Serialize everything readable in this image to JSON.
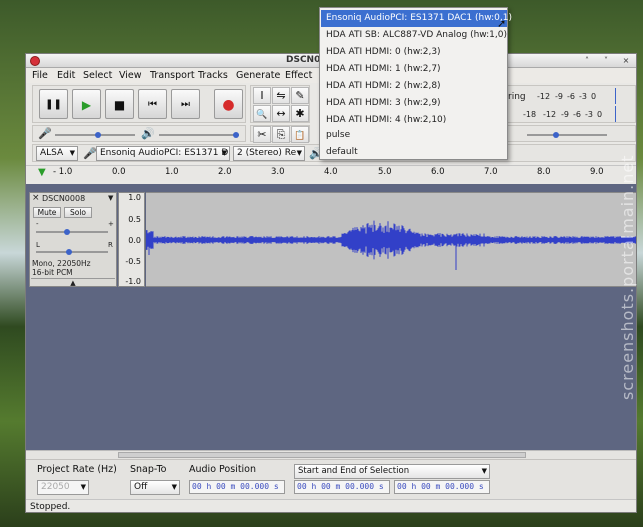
{
  "window": {
    "title": "DSCN00",
    "close": "×",
    "minimize": "˄",
    "maximize": "˅"
  },
  "menu": [
    "File",
    "Edit",
    "Select",
    "View",
    "Transport",
    "Tracks",
    "Generate",
    "Effect"
  ],
  "transport": {
    "pause": "❚❚",
    "play": "▶",
    "stop": "■",
    "skip_start": "⏮",
    "skip_end": "⏭",
    "record": "●"
  },
  "tools": {
    "select": "I",
    "envelope": "⇋",
    "draw": "✎",
    "zoom": "🔍",
    "timeshift": "↔",
    "multi": "✱"
  },
  "edit": {
    "cut": "✂",
    "copy": "⎘",
    "paste": "📋"
  },
  "meters": {
    "recording_label": "ring",
    "play_ticks": [
      "-12",
      "-9",
      "-6",
      "-3",
      "0"
    ],
    "rec_ticks": [
      "-18",
      "-12",
      "-9",
      "-6",
      "-3",
      "0"
    ]
  },
  "device": {
    "host": "ALSA",
    "input_device": "Ensoniq AudioPCI: ES1371 D",
    "channels": "2 (Stereo) Re"
  },
  "ruler": {
    "ticks": [
      "- 1.0",
      "0.0",
      "1.0",
      "2.0",
      "3.0",
      "4.0",
      "5.0",
      "6.0",
      "7.0",
      "8.0",
      "9.0"
    ]
  },
  "track": {
    "name": "DSCN0008",
    "mute": "Mute",
    "solo": "Solo",
    "gain_minus": "-",
    "gain_plus": "+",
    "pan_left": "L",
    "pan_right": "R",
    "info_rate": "Mono, 22050Hz",
    "info_format": "16-bit PCM",
    "collapse": "▲",
    "close": "×",
    "menu_arrow": "▼",
    "vscale": [
      "1.0",
      "0.5",
      "0.0",
      "-0.5",
      "-1.0"
    ]
  },
  "selection_toolbar": {
    "project_rate_label": "Project Rate (Hz)",
    "project_rate_value": "22050",
    "snap_to_label": "Snap-To",
    "snap_to_value": "Off",
    "audio_position_label": "Audio Position",
    "selection_mode": "Start and End of Selection",
    "audio_position": "00 h 00 m 00.000 s",
    "sel_start": "00 h 00 m 00.000 s",
    "sel_end": "00 h 00 m 00.000 s"
  },
  "status": "Stopped.",
  "dropdown": {
    "items": [
      "Ensoniq AudioPCI: ES1371 DAC1 (hw:0,1)",
      "HDA ATI SB: ALC887-VD Analog (hw:1,0)",
      "HDA ATI HDMI: 0 (hw:2,3)",
      "HDA ATI HDMI: 1 (hw:2,7)",
      "HDA ATI HDMI: 2 (hw:2,8)",
      "HDA ATI HDMI: 3 (hw:2,9)",
      "HDA ATI HDMI: 4 (hw:2,10)",
      "pulse",
      "default"
    ],
    "selected_index": 0
  },
  "watermark": "screenshots.portalmain.net"
}
